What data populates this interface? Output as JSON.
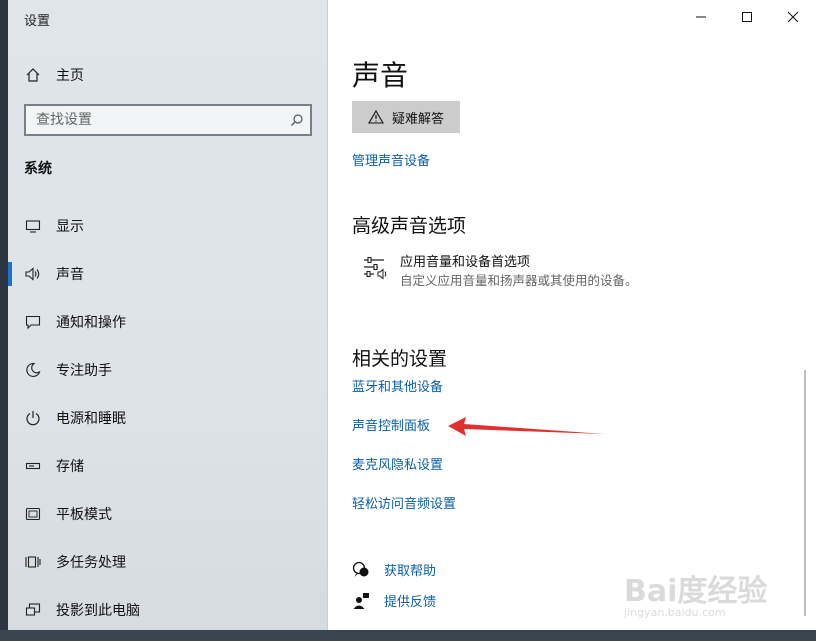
{
  "window": {
    "app_title": "设置",
    "page_title": "声音"
  },
  "sidebar": {
    "home": "主页",
    "search_placeholder": "查找设置",
    "section": "系统",
    "items": [
      {
        "label": "显示",
        "icon": "monitor-icon"
      },
      {
        "label": "声音",
        "icon": "speaker-icon",
        "active": true
      },
      {
        "label": "通知和操作",
        "icon": "notification-icon"
      },
      {
        "label": "专注助手",
        "icon": "moon-icon"
      },
      {
        "label": "电源和睡眠",
        "icon": "power-icon"
      },
      {
        "label": "存储",
        "icon": "storage-icon"
      },
      {
        "label": "平板模式",
        "icon": "tablet-icon"
      },
      {
        "label": "多任务处理",
        "icon": "multitask-icon"
      },
      {
        "label": "投影到此电脑",
        "icon": "project-icon"
      }
    ]
  },
  "main": {
    "troubleshoot_label": "疑难解答",
    "manage_devices_link": "管理声音设备",
    "advanced": {
      "title": "高级声音选项",
      "item_title": "应用音量和设备首选项",
      "item_desc": "自定义应用音量和扬声器或其使用的设备。"
    },
    "related": {
      "title": "相关的设置",
      "links": [
        "蓝牙和其他设备",
        "声音控制面板",
        "麦克风隐私设置",
        "轻松访问音频设置"
      ]
    },
    "help": {
      "get_help": "获取帮助",
      "feedback": "提供反馈"
    }
  },
  "watermark": {
    "brand": "Bai度经验",
    "url": "jingyan.baidu.com"
  },
  "colors": {
    "link": "#0b5fa8",
    "accent": "#1a73c8",
    "arrow": "#e03030"
  }
}
